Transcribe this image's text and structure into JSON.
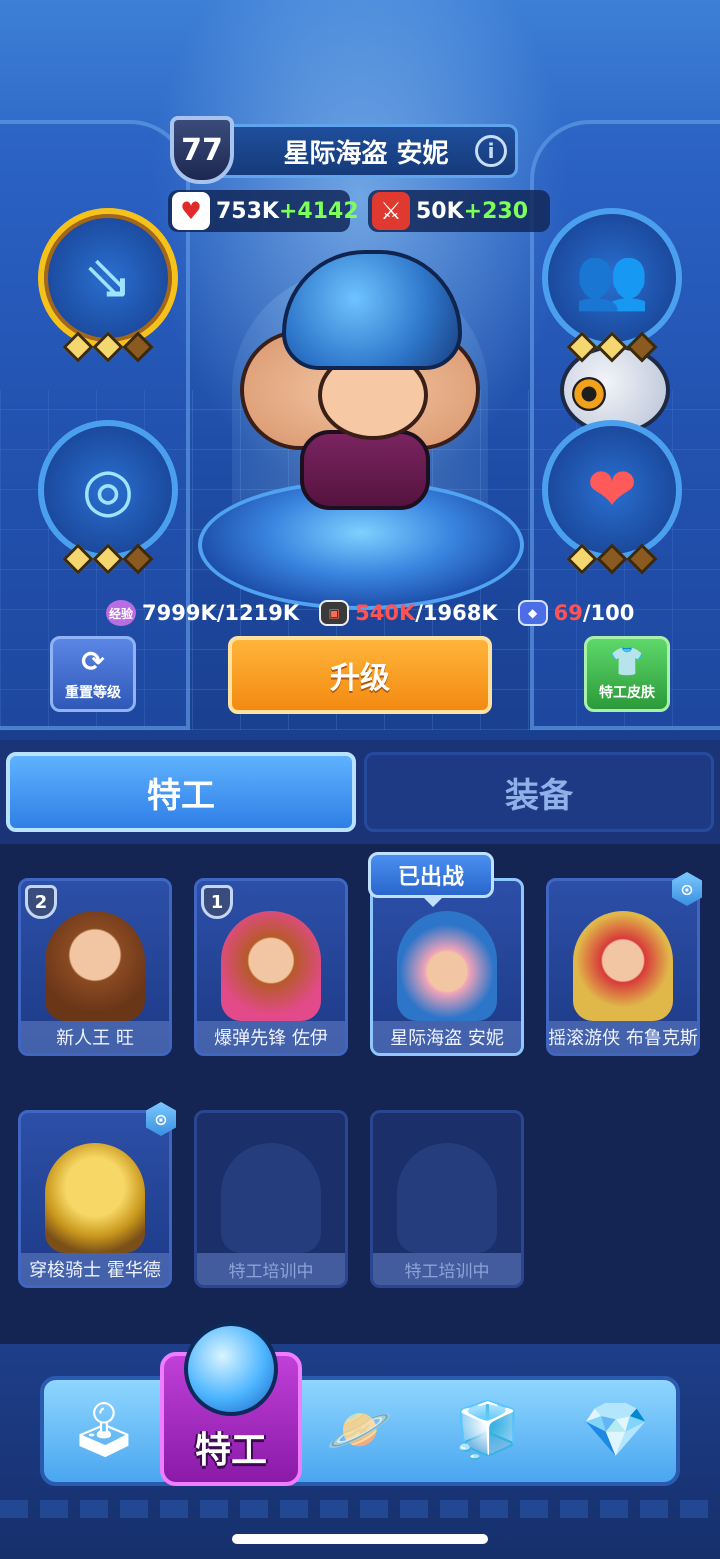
{
  "hero": {
    "level": "77",
    "name": "星际海盗 安妮",
    "info_icon": "i",
    "hp": {
      "value": "753K",
      "bonus": "+4142",
      "icon": "heart-icon"
    },
    "attack": {
      "value": "50K",
      "bonus": "+230",
      "icon": "sword-icon"
    }
  },
  "skills": [
    {
      "id": "top-left",
      "icon": "arrows-skill-icon",
      "glyph": "⇘",
      "stars": 3,
      "filled": 2,
      "highlighted": true
    },
    {
      "id": "mid-left",
      "icon": "target-skill-icon",
      "glyph": "◎",
      "stars": 3,
      "filled": 2,
      "highlighted": false
    },
    {
      "id": "top-right",
      "icon": "clone-skill-icon",
      "glyph": "👥",
      "stars": 3,
      "filled": 2,
      "highlighted": false
    },
    {
      "id": "mid-right",
      "icon": "hearts-skill-icon",
      "glyph": "❤",
      "stars": 3,
      "filled": 1,
      "highlighted": false
    }
  ],
  "resources": {
    "exp_label": "经验",
    "exp_text": "7999K/1219K",
    "tape_current": "540K",
    "tape_total": "/1968K",
    "chip_current": "69",
    "chip_total": "/100",
    "tape_icon_label": "▣",
    "chip_icon_label": "◆"
  },
  "buttons": {
    "reset_icon": "⟳",
    "reset_label": "重置等级",
    "upgrade_label": "升级",
    "skin_icon": "👕",
    "skin_label": "特工皮肤"
  },
  "tabs": {
    "agents": "特工",
    "equipment": "装备"
  },
  "roster": {
    "deployed_tag": "已出战",
    "cards": [
      {
        "name": "新人王 旺",
        "rank": "2",
        "locked": false,
        "training": false
      },
      {
        "name": "爆弹先锋 佐伊",
        "rank": "1",
        "locked": false,
        "training": false
      },
      {
        "name": "星际海盗 安妮",
        "rank": "",
        "locked": false,
        "training": false,
        "deployed": true
      },
      {
        "name": "摇滚游侠 布鲁克斯",
        "rank": "",
        "locked": true,
        "training": false
      },
      {
        "name": "穿梭骑士 霍华德",
        "rank": "",
        "locked": true,
        "training": false
      },
      {
        "name": "特工培训中",
        "rank": "",
        "locked": false,
        "training": true
      },
      {
        "name": "特工培训中",
        "rank": "",
        "locked": false,
        "training": true
      }
    ]
  },
  "nav": {
    "active_label": "特工",
    "items": [
      {
        "name": "arcade-machine-icon",
        "glyph": "🕹"
      },
      {
        "name": "agent-helmet-icon",
        "glyph": ""
      },
      {
        "name": "planet-icon",
        "glyph": "🪐"
      },
      {
        "name": "crystal-cube-icon",
        "glyph": "🧊"
      },
      {
        "name": "green-gem-card-icon",
        "glyph": "💎"
      }
    ]
  },
  "colors": {
    "upgrade": "#f38a12",
    "skin_button": "#2c9a3a",
    "active_tab": "#2f7fe6",
    "nav_active": "#8a1aa8",
    "bonus_green": "#7dff5a",
    "resource_red": "#ff5252"
  }
}
